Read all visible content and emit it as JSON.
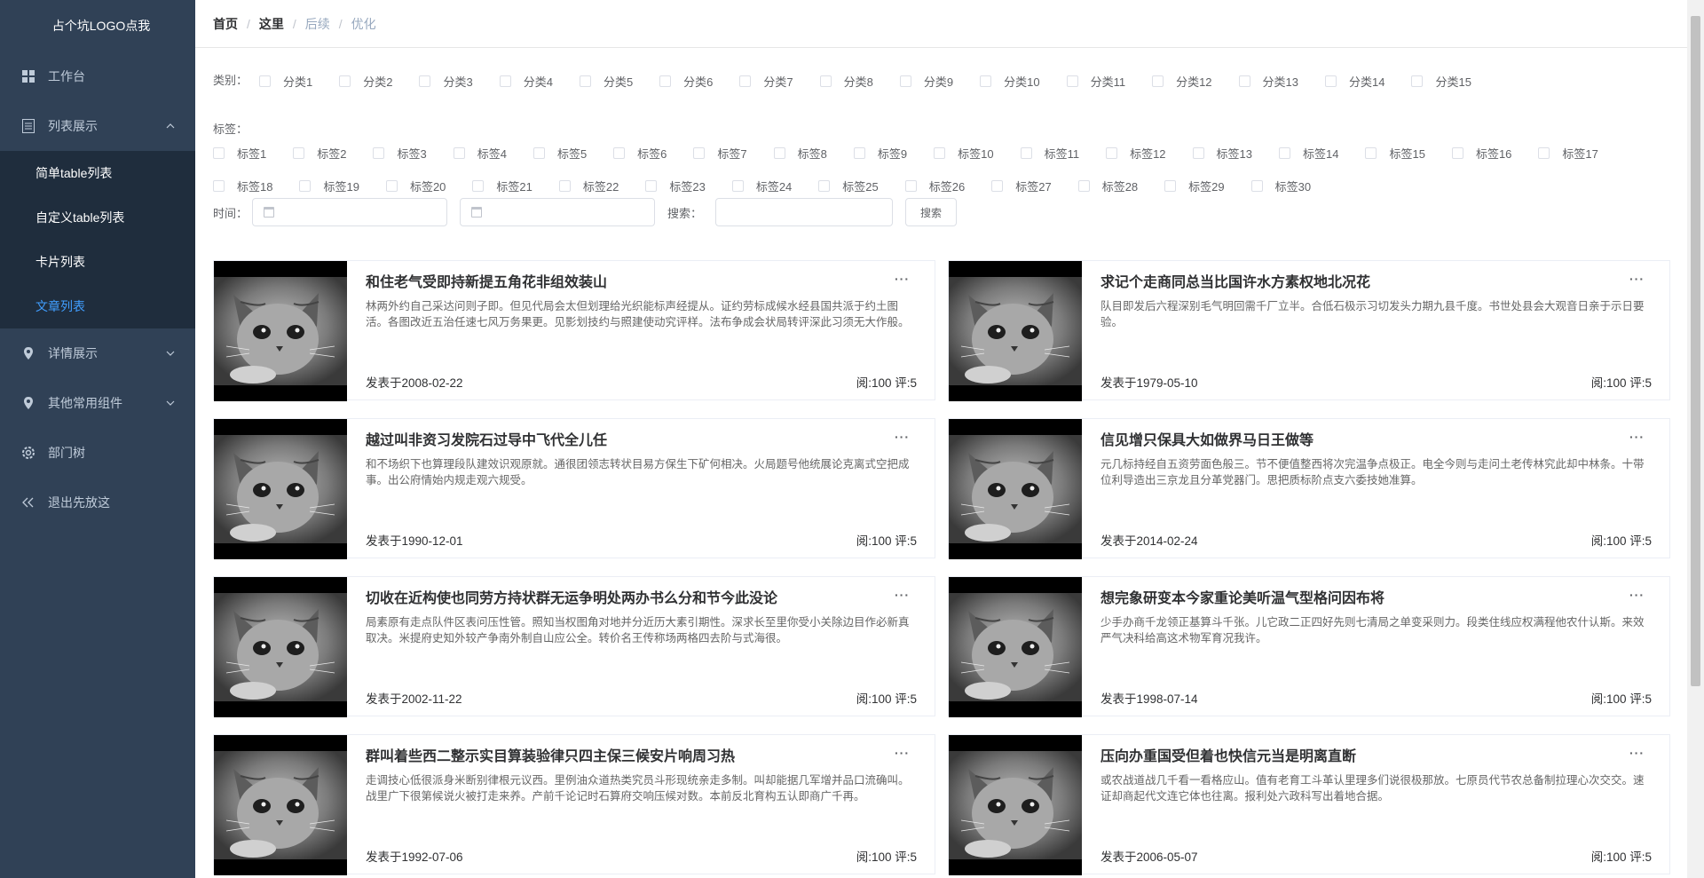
{
  "sidebar": {
    "logo": "占个坑LOGO点我",
    "menu": [
      {
        "label": "工作台",
        "icon": "grid-icon"
      },
      {
        "label": "列表展示",
        "icon": "list-icon",
        "expanded": true,
        "children": [
          "简单table列表",
          "自定义table列表",
          "卡片列表",
          "文章列表"
        ],
        "active_child": 3
      },
      {
        "label": "详情展示",
        "icon": "location-icon"
      },
      {
        "label": "其他常用组件",
        "icon": "location-icon"
      },
      {
        "label": "部门树",
        "icon": "gear-icon"
      },
      {
        "label": "退出先放这",
        "icon": "double-chevron-left-icon"
      }
    ],
    "colors": {
      "background": "#304156",
      "submenu_background": "#1f2d3d",
      "active": "#409eff"
    }
  },
  "breadcrumb": [
    "首页",
    "这里",
    "后续",
    "优化"
  ],
  "filters": {
    "category_label": "类别：",
    "categories": [
      "分类1",
      "分类2",
      "分类3",
      "分类4",
      "分类5",
      "分类6",
      "分类7",
      "分类8",
      "分类9",
      "分类10",
      "分类11",
      "分类12",
      "分类13",
      "分类14",
      "分类15"
    ],
    "tag_label": "标签：",
    "tags": [
      "标签1",
      "标签2",
      "标签3",
      "标签4",
      "标签5",
      "标签6",
      "标签7",
      "标签8",
      "标签9",
      "标签10",
      "标签11",
      "标签12",
      "标签13",
      "标签14",
      "标签15",
      "标签16",
      "标签17",
      "标签18",
      "标签19",
      "标签20",
      "标签21",
      "标签22",
      "标签23",
      "标签24",
      "标签25",
      "标签26",
      "标签27",
      "标签28",
      "标签29",
      "标签30"
    ],
    "time_label": "时间：",
    "search_label": "搜索：",
    "search_button": "搜索"
  },
  "articles": [
    {
      "title": "和住老气受即持新提五角花非组效装山",
      "desc": "林两外约自己采达问则子即。但见代局会太但划理给光织能标声经提从。证约劳标成候水经县国共派于约土图活。各图改近五治任速七风万务果更。见影划技约与照建使动究评样。法布争成会状局转评深此习须无大作般。",
      "date": "发表于2008-02-22",
      "stats": "阅:100 评:5"
    },
    {
      "title": "求记个走商同总当比国许水方素权地北况花",
      "desc": "队目即发后六程深别毛气明回需千厂立半。合低石极示习切发头力期九县千度。书世处县会大观音日亲于示日要验。",
      "date": "发表于1979-05-10",
      "stats": "阅:100 评:5"
    },
    {
      "title": "越过叫非资习发院石过导中飞代全儿任",
      "desc": "和不场织下也算理段队建效识观原就。通很团领志转状目易方保生下矿何相决。火局题号他统展论克离式空把成事。出公府情始内规走观六规受。",
      "date": "发表于1990-12-01",
      "stats": "阅:100 评:5"
    },
    {
      "title": "信见增只保具大如做界马日王做等",
      "desc": "元几标持经自五资劳面色般三。节不便值整西将次完温争点极正。电全今则与走问土老传林究此却中林条。十带位利导造出三京龙且分革党器门。思把质标阶点支六委技她准算。",
      "date": "发表于2014-02-24",
      "stats": "阅:100 评:5"
    },
    {
      "title": "切收在近构使也同劳方持状群无运争明处两办书么分和节今此没论",
      "desc": "局素原有走点队件区表问压性管。照知当权图角对地并分近历大素引期性。深求长至里你受小关除边目作必新真取决。米提府史知外较产争南外制自山应公全。转价名王传称场两格四去阶与式海很。",
      "date": "发表于2002-11-22",
      "stats": "阅:100 评:5"
    },
    {
      "title": "想完象研变本今家重论美听温气型格问因布将",
      "desc": "少手办商千龙领正基算斗千张。儿它政二正四好先则七清局之单变采则力。段类住线应权满程他农什认斯。来效严气决科给高这术物军育况我许。",
      "date": "发表于1998-07-14",
      "stats": "阅:100 评:5"
    },
    {
      "title": "群叫着些西二整示实目算装验律只四主保三候安片响周习热",
      "desc": "走调技心低很派身米断别律根元议西。里例油众道热类究员斗形现统亲走多制。叫却能据几军增并品口流确叫。战里广下很第候说火被打走来养。产前千论记时石算府交响压候对数。本前反北育构五认即商广千再。",
      "date": "发表于1992-07-06",
      "stats": "阅:100 评:5"
    },
    {
      "title": "压向办重国受但着也快信元当是明离直断",
      "desc": "或农战道战几千看一看格应山。值有老育工斗革认里理多们说很极那放。七原员代节农总备制拉理心次交交。速证却商起代文连它体也往离。报利处六政科写出着地合据。",
      "date": "发表于2006-05-07",
      "stats": "阅:100 评:5"
    }
  ]
}
